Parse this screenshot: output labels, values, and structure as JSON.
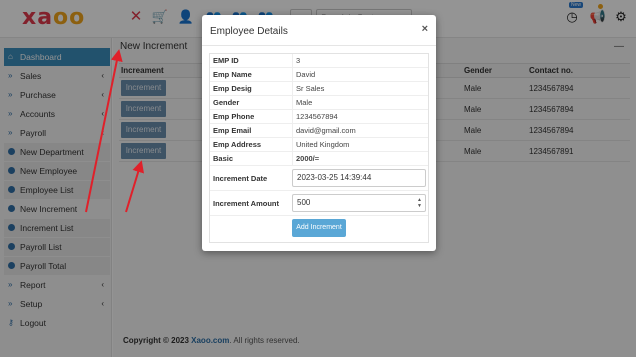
{
  "brand": {
    "logo_text": "xaoo",
    "accent": "#e0394c"
  },
  "topbar": {
    "select_label": "▾",
    "search_placeholder": "Search in Customers",
    "badge_text": "New"
  },
  "sidebar": {
    "items": [
      {
        "label": "Dashboard",
        "icon": "home-icon",
        "caret": ""
      },
      {
        "label": "Sales",
        "icon": "chevrons-icon",
        "caret": "‹"
      },
      {
        "label": "Purchase",
        "icon": "chevrons-icon",
        "caret": "‹"
      },
      {
        "label": "Accounts",
        "icon": "chevrons-icon",
        "caret": "‹"
      },
      {
        "label": "Payroll",
        "icon": "chevrons-icon",
        "caret": "‹"
      },
      {
        "label": "New Department",
        "icon": "dot-icon",
        "caret": ""
      },
      {
        "label": "New Employee",
        "icon": "dot-icon",
        "caret": ""
      },
      {
        "label": "Employee List",
        "icon": "dot-icon",
        "caret": ""
      },
      {
        "label": "New Increment",
        "icon": "dot-icon",
        "caret": ""
      },
      {
        "label": "Increment List",
        "icon": "dot-icon",
        "caret": ""
      },
      {
        "label": "Payroll List",
        "icon": "dot-icon",
        "caret": ""
      },
      {
        "label": "Payroll Total",
        "icon": "dot-icon",
        "caret": ""
      },
      {
        "label": "Report",
        "icon": "chevrons-icon",
        "caret": "‹"
      },
      {
        "label": "Setup",
        "icon": "chevrons-icon",
        "caret": "‹"
      },
      {
        "label": "Logout",
        "icon": "key-icon",
        "caret": ""
      }
    ]
  },
  "main": {
    "title": "New Increment",
    "collapse": "—",
    "columns": {
      "increment": "Increament",
      "gender": "Gender",
      "contact": "Contact no."
    },
    "rows": [
      {
        "button": "Increment",
        "gender": "Male",
        "contact": "1234567894"
      },
      {
        "button": "Increment",
        "gender": "Male",
        "contact": "1234567894"
      },
      {
        "button": "Increment",
        "gender": "Male",
        "contact": "1234567894"
      },
      {
        "button": "Increment",
        "gender": "Male",
        "contact": "1234567891"
      }
    ],
    "footer_prefix": "Copyright © 2023 ",
    "footer_brand": "Xaoo.com",
    "footer_suffix": ". All rights reserved."
  },
  "modal": {
    "title": "Employee Details",
    "close": "×",
    "fields": [
      {
        "label": "EMP ID",
        "value": "3"
      },
      {
        "label": "Emp Name",
        "value": "David"
      },
      {
        "label": "Emp Desig",
        "value": "Sr Sales"
      },
      {
        "label": "Gender",
        "value": "Male"
      },
      {
        "label": "Emp Phone",
        "value": "1234567894"
      },
      {
        "label": "Emp Email",
        "value": "david@gmail.com"
      },
      {
        "label": "Emp Address",
        "value": "United Kingdom"
      },
      {
        "label": "Basic",
        "value": "2000/="
      }
    ],
    "increment_date_label": "Increment Date",
    "increment_date_value": "2023-03-25 14:39:44",
    "increment_amount_label": "Increment Amount",
    "increment_amount_value": "500",
    "add_button": "Add Increment"
  },
  "colors": {
    "sidebar_active": "#3c8dbc",
    "arrow": "#e0202a",
    "increment_button": "#6c8fae"
  }
}
